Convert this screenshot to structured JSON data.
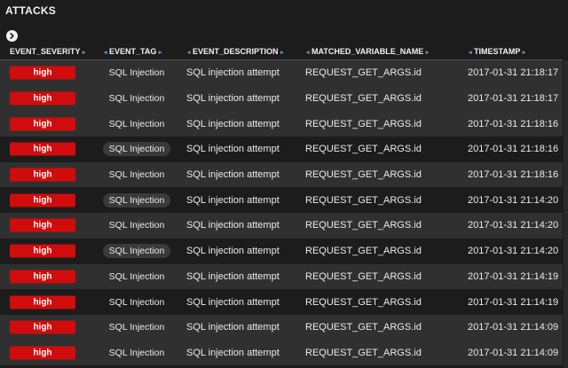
{
  "panel": {
    "title": "ATTACKS"
  },
  "icons": {
    "expand": "chevron-right-circle-icon",
    "sort_left": "caret-left-icon",
    "sort_right": "caret-right-icon"
  },
  "colors": {
    "severity_high": "#d10c0c",
    "sort_arrow": "#4a9fd8"
  },
  "table": {
    "columns": [
      "EVENT_SEVERITY",
      "EVENT_TAG",
      "EVENT_DESCRIPTION",
      "MATCHED_VARIABLE_NAME",
      "TIMESTAMP"
    ],
    "rows": [
      {
        "severity": "high",
        "tag": "SQL Injection",
        "description": "SQL injection attempt",
        "variable": "REQUEST_GET_ARGS.id",
        "timestamp": "2017-01-31 21:18:17"
      },
      {
        "severity": "high",
        "tag": "SQL Injection",
        "description": "SQL injection attempt",
        "variable": "REQUEST_GET_ARGS.id",
        "timestamp": "2017-01-31 21:18:17"
      },
      {
        "severity": "high",
        "tag": "SQL Injection",
        "description": "SQL injection attempt",
        "variable": "REQUEST_GET_ARGS.id",
        "timestamp": "2017-01-31 21:18:16"
      },
      {
        "severity": "high",
        "tag": "SQL Injection",
        "description": "SQL injection attempt",
        "variable": "REQUEST_GET_ARGS.id",
        "timestamp": "2017-01-31 21:18:16"
      },
      {
        "severity": "high",
        "tag": "SQL Injection",
        "description": "SQL injection attempt",
        "variable": "REQUEST_GET_ARGS.id",
        "timestamp": "2017-01-31 21:18:16"
      },
      {
        "severity": "high",
        "tag": "SQL Injection",
        "description": "SQL injection attempt",
        "variable": "REQUEST_GET_ARGS.id",
        "timestamp": "2017-01-31 21:14:20"
      },
      {
        "severity": "high",
        "tag": "SQL Injection",
        "description": "SQL injection attempt",
        "variable": "REQUEST_GET_ARGS.id",
        "timestamp": "2017-01-31 21:14:20"
      },
      {
        "severity": "high",
        "tag": "SQL Injection",
        "description": "SQL injection attempt",
        "variable": "REQUEST_GET_ARGS.id",
        "timestamp": "2017-01-31 21:14:20"
      },
      {
        "severity": "high",
        "tag": "SQL Injection",
        "description": "SQL injection attempt",
        "variable": "REQUEST_GET_ARGS.id",
        "timestamp": "2017-01-31 21:14:19"
      },
      {
        "severity": "high",
        "tag": "SQL Injection",
        "description": "SQL injection attempt",
        "variable": "REQUEST_GET_ARGS.id",
        "timestamp": "2017-01-31 21:14:19"
      },
      {
        "severity": "high",
        "tag": "SQL Injection",
        "description": "SQL injection attempt",
        "variable": "REQUEST_GET_ARGS.id",
        "timestamp": "2017-01-31 21:14:09"
      },
      {
        "severity": "high",
        "tag": "SQL Injection",
        "description": "SQL injection attempt",
        "variable": "REQUEST_GET_ARGS.id",
        "timestamp": "2017-01-31 21:14:09"
      }
    ]
  }
}
